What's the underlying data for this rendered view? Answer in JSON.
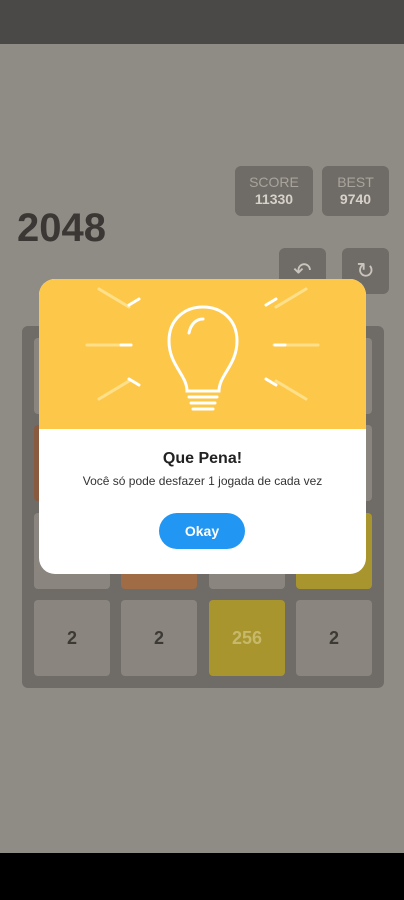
{
  "game": {
    "title": "2048",
    "score_label": "SCORE",
    "score_value": "11330",
    "best_label": "BEST",
    "best_value": "9740",
    "undo_icon": "undo-icon",
    "restart_icon": "restart-icon",
    "visible_tiles": [
      "2",
      "2",
      "256",
      "2"
    ]
  },
  "dialog": {
    "title": "Que Pena!",
    "message": "Você só pode desfazer 1 jogada de cada vez",
    "button_label": "Okay",
    "header_color": "#fdc84a",
    "button_color": "#2196f3",
    "icon": "lightbulb-icon"
  }
}
